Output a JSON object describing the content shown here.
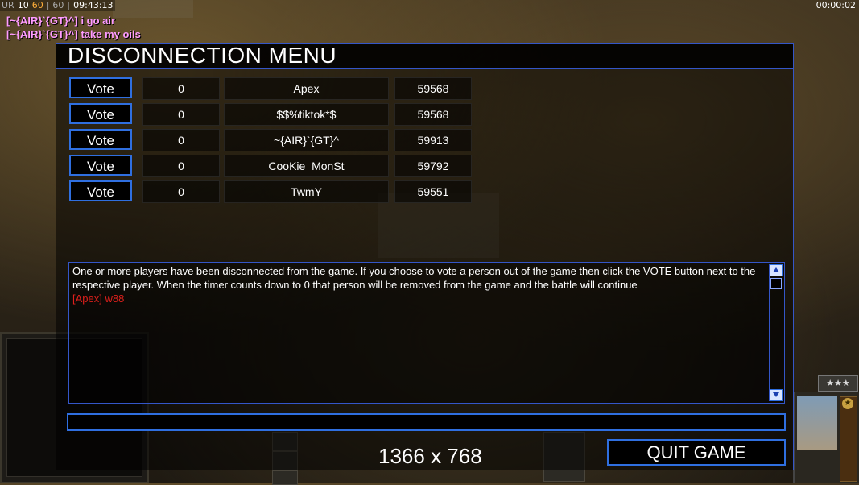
{
  "hud": {
    "prefix": "UR",
    "fps": "10",
    "frame_a": "60",
    "frame_b": "60",
    "game_time": "09:43:13",
    "elapsed": "00:00:02"
  },
  "chat": [
    "[~{AIR}`{GT}^] i go air",
    "[~{AIR}`{GT}^] take my oils"
  ],
  "dialog": {
    "title": "DISCONNECTION MENU",
    "players": [
      {
        "vote_label": "Vote",
        "votes": "0",
        "name": "Apex",
        "ping": "59568"
      },
      {
        "vote_label": "Vote",
        "votes": "0",
        "name": "$$%tiktok*$",
        "ping": "59568"
      },
      {
        "vote_label": "Vote",
        "votes": "0",
        "name": "~{AIR}`{GT}^",
        "ping": "59913"
      },
      {
        "vote_label": "Vote",
        "votes": "0",
        "name": "CooKie_MonSt",
        "ping": "59792"
      },
      {
        "vote_label": "Vote",
        "votes": "0",
        "name": "TwmY",
        "ping": "59551"
      }
    ],
    "info_message": "One or more players have been disconnected from the game. If you choose to vote a person out of the game then click the VOTE button next to the respective player. When the timer counts down to 0 that person will be removed from the game and the battle will continue",
    "chat_line": "[Apex] w88",
    "chat_input_value": "",
    "resolution": "1366 x 768",
    "quit_label": "QUIT GAME"
  },
  "colors": {
    "accent_blue": "#2f6fe0",
    "chat_pink": "#ff9cff",
    "chat_red": "#e0201c",
    "hud_orange": "#ffae3a"
  }
}
